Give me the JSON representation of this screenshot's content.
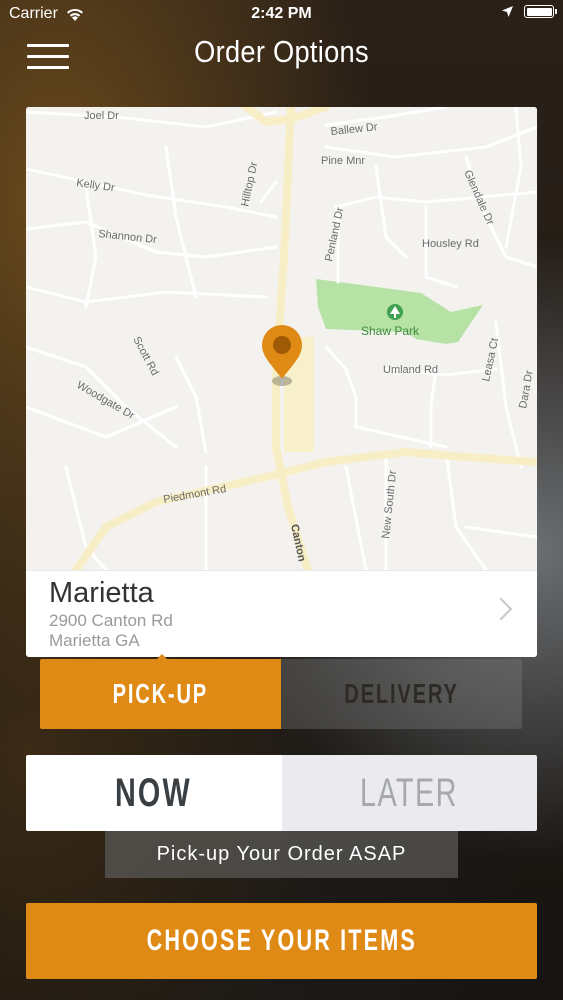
{
  "status_bar": {
    "carrier": "Carrier",
    "time": "2:42 PM",
    "icons": [
      "wifi-icon",
      "location-arrow-icon",
      "battery-icon"
    ]
  },
  "nav": {
    "title": "Order Options",
    "menu_icon": "hamburger-menu-icon"
  },
  "map": {
    "street_labels": {
      "joel": "Joel Dr",
      "ballew": "Ballew Dr",
      "pine": "Pine Mnr",
      "hilltop": "Hilltop Dr",
      "kelly": "Kelly Dr",
      "glendale": "Glendale Dr",
      "shannon": "Shannon Dr",
      "penland": "Penland Dr",
      "housley": "Housley Rd",
      "shaw_park": "Shaw Park",
      "scott": "Scott Rd",
      "umland": "Umland Rd",
      "leasa": "Leasa Ct",
      "dara": "Dara Dr",
      "woodgate": "Woodgate Dr",
      "piedmont": "Piedmont Rd",
      "new_south": "New South Dr",
      "canton": "Canton"
    },
    "colors": {
      "land": "#f4f2ee",
      "park": "#b6e2a6",
      "major_road": "#f8eec6",
      "pin": "#e08a16"
    }
  },
  "location": {
    "name": "Marietta",
    "address_line1": "2900 Canton Rd",
    "address_line2": "Marietta GA"
  },
  "order_mode": {
    "pickup_label": "PICK-UP",
    "delivery_label": "DELIVERY",
    "selected": "PICK-UP"
  },
  "order_time": {
    "now_label": "NOW",
    "later_label": "LATER",
    "selected": "NOW"
  },
  "hint": "Pick-up Your Order ASAP",
  "cta_label": "CHOOSE YOUR ITEMS",
  "accent_color": "#e08a16"
}
